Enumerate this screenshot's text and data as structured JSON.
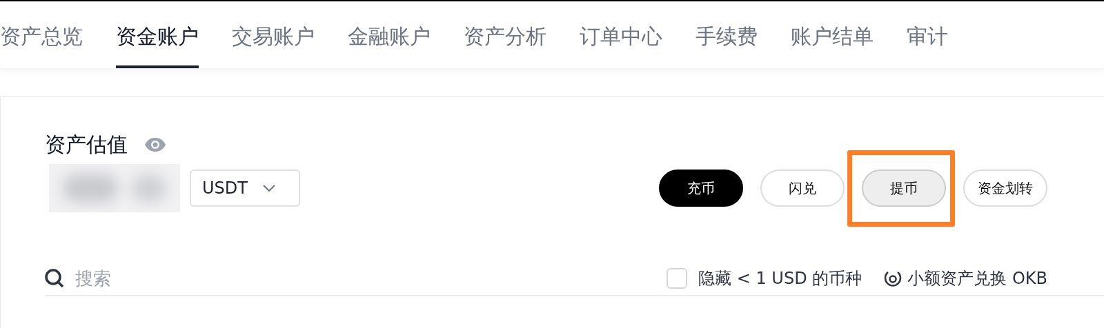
{
  "tabs": [
    {
      "label": "资产总览",
      "selected": false
    },
    {
      "label": "资金账户",
      "selected": true
    },
    {
      "label": "交易账户",
      "selected": false
    },
    {
      "label": "金融账户",
      "selected": false
    },
    {
      "label": "资产分析",
      "selected": false
    },
    {
      "label": "订单中心",
      "selected": false
    },
    {
      "label": "手续费",
      "selected": false
    },
    {
      "label": "账户结单",
      "selected": false
    },
    {
      "label": "审计",
      "selected": false
    }
  ],
  "valuation": {
    "title": "资产估值",
    "currency": "USDT"
  },
  "actions": [
    {
      "label": "充币",
      "kind": "primary",
      "highlighted": false
    },
    {
      "label": "闪兑",
      "kind": "outline",
      "highlighted": false
    },
    {
      "label": "提币",
      "kind": "outline",
      "highlighted": true
    },
    {
      "label": "资金划转",
      "kind": "outline",
      "highlighted": false
    }
  ],
  "search": {
    "placeholder": "搜索"
  },
  "hide_small": {
    "label": "隐藏 < 1 USD 的币种",
    "checked": false
  },
  "convert_link": {
    "label": "小额资产兑换 OKB"
  }
}
